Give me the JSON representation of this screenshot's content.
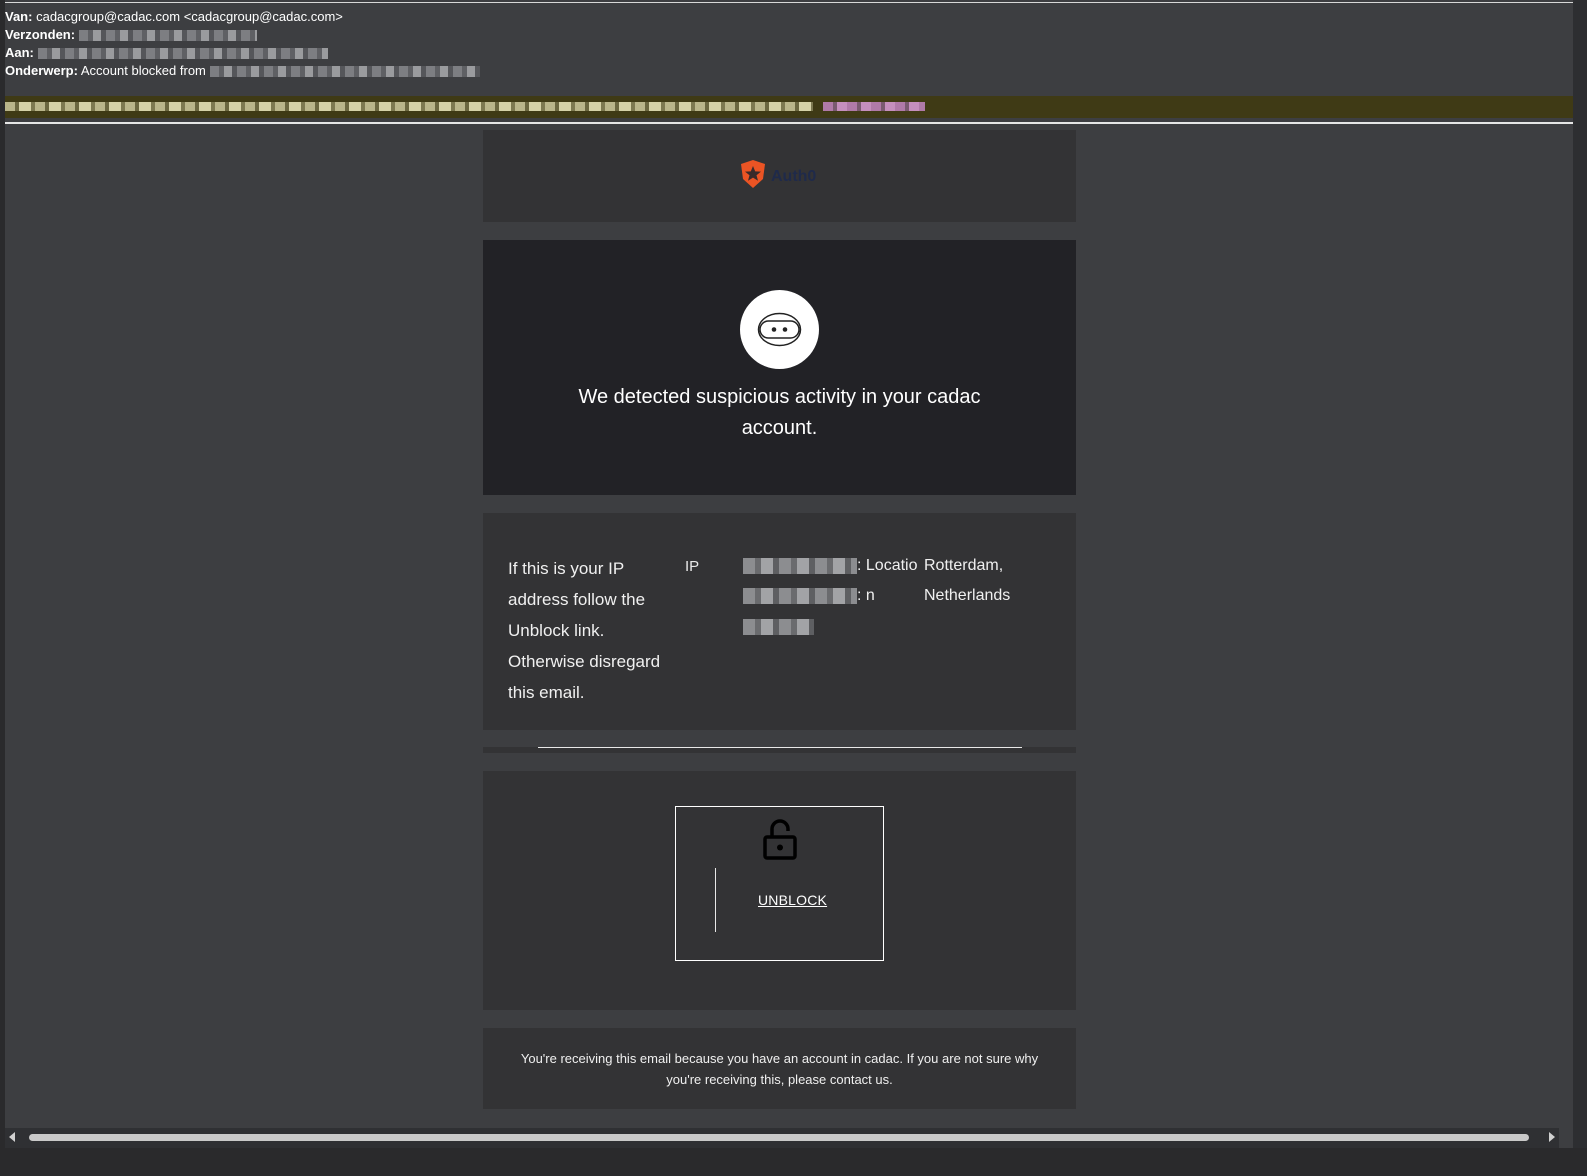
{
  "email_header": {
    "from_label": "Van:",
    "from_value": "cadacgroup@cadac.com <cadacgroup@cadac.com>",
    "sent_label": "Verzonden:",
    "to_label": "Aan:",
    "subject_label": "Onderwerp:",
    "subject_value": "Account blocked from"
  },
  "logo": {
    "text": "Auth0",
    "icon": "auth0-shield-icon",
    "brand_color": "#eb5424"
  },
  "alert": {
    "icon": "robot-face-icon",
    "message": "We detected suspicious activity in your cadac account."
  },
  "info": {
    "message": "If this is your IP address follow the Unblock link. Otherwise disregard this email.",
    "ip_label": "IP",
    "location_label_1": ": Locatio",
    "location_label_2": ": n",
    "location_value_1": "Rotterdam,",
    "location_value_2": "Netherlands"
  },
  "action": {
    "icon": "unlock-icon",
    "button_label": "UNBLOCK"
  },
  "footer": {
    "text": "You're receiving this email because you have an account in cadac. If you are not sure why you're receiving this, please contact us."
  },
  "colors": {
    "page_bg": "#3d3e41",
    "card_bg": "#333335",
    "alert_bg": "#222226",
    "warning_bar": "#3f3a15"
  }
}
